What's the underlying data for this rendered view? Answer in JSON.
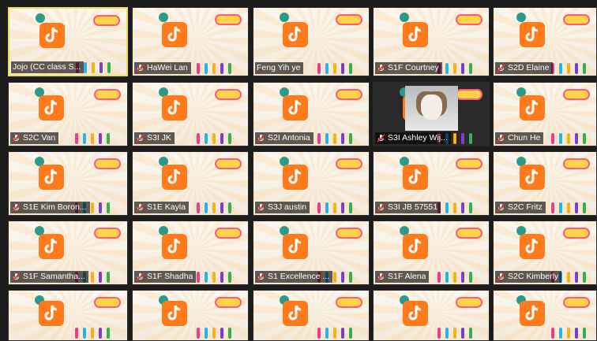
{
  "colors": {
    "active_border": "#e8e25a",
    "tiktok_orange": "#ff7a1a",
    "tile_bg": "#f4efe6"
  },
  "tiles": [
    {
      "label": "Jojo (CC class S...",
      "muted": false,
      "kind": "person"
    },
    {
      "label": "HaWei Lan",
      "muted": true,
      "kind": "person"
    },
    {
      "label": "Feng Yih ye",
      "muted": false,
      "kind": "person"
    },
    {
      "label": "S1F Courtney",
      "muted": true,
      "kind": "person"
    },
    {
      "label": "S2D Elaine",
      "muted": true,
      "kind": "background"
    },
    {
      "label": "S2C Van",
      "muted": true,
      "kind": "background"
    },
    {
      "label": "S3I JK",
      "muted": true,
      "kind": "person"
    },
    {
      "label": "S2I Antonia",
      "muted": true,
      "kind": "person"
    },
    {
      "label": "S3I Ashley Wij...",
      "muted": true,
      "kind": "dog"
    },
    {
      "label": "Chun He",
      "muted": true,
      "kind": "person"
    },
    {
      "label": "S1E Kim Boron...",
      "muted": true,
      "kind": "person"
    },
    {
      "label": "S1E Kayla",
      "muted": true,
      "kind": "person"
    },
    {
      "label": "S3J austin",
      "muted": true,
      "kind": "background"
    },
    {
      "label": "S3I JB 57551",
      "muted": true,
      "kind": "person"
    },
    {
      "label": "S2C Fritz",
      "muted": true,
      "kind": "person"
    },
    {
      "label": "S1F Samantha...",
      "muted": true,
      "kind": "person"
    },
    {
      "label": "S1F Shadha",
      "muted": true,
      "kind": "person"
    },
    {
      "label": "S1 Excellence ...",
      "muted": true,
      "kind": "person"
    },
    {
      "label": "S1F Alena",
      "muted": true,
      "kind": "person"
    },
    {
      "label": "S2C Kimberly",
      "muted": true,
      "kind": "person"
    },
    {
      "label": "",
      "muted": false,
      "kind": "person"
    },
    {
      "label": "",
      "muted": false,
      "kind": "background"
    },
    {
      "label": "",
      "muted": false,
      "kind": "person"
    },
    {
      "label": "",
      "muted": false,
      "kind": "person"
    },
    {
      "label": "",
      "muted": false,
      "kind": "person"
    }
  ]
}
